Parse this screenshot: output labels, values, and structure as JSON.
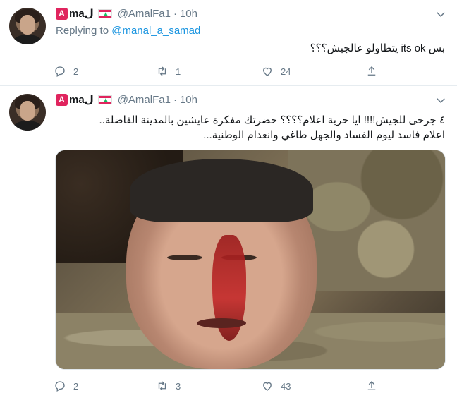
{
  "tweets": [
    {
      "author": {
        "badge": "A",
        "name": "maل",
        "flag": "lebanon-flag-icon",
        "handle": "@AmalFa1",
        "separator": "·",
        "time": "10h"
      },
      "replying": {
        "prefix": "Replying to",
        "user": "@manal_a_samad"
      },
      "text": "بس its ok يتطاولو عالجيش؟؟؟",
      "stats": {
        "replies": "2",
        "retweets": "1",
        "likes": "24"
      }
    },
    {
      "author": {
        "badge": "A",
        "name": "maل",
        "flag": "lebanon-flag-icon",
        "handle": "@AmalFa1",
        "separator": "·",
        "time": "10h"
      },
      "text_line1": "٤ جرحى للجيش!!!!  ايا حرية اعلام؟؟؟؟  حضرتك مفكرة عايشين بالمدينة الفاضلة..",
      "text_line2": "اعلام فاسد ليوم الفساد والجهل طاغي وانعدام الوطنية...",
      "media": "photo of injured soldier",
      "stats": {
        "replies": "2",
        "retweets": "3",
        "likes": "43"
      }
    }
  ],
  "colors": {
    "accent": "#1b95e0",
    "muted": "#657786",
    "text": "#14171a",
    "badge": "#e0245e"
  },
  "icons": [
    "reply-icon",
    "retweet-icon",
    "like-icon",
    "share-icon",
    "chevron-down-icon"
  ]
}
